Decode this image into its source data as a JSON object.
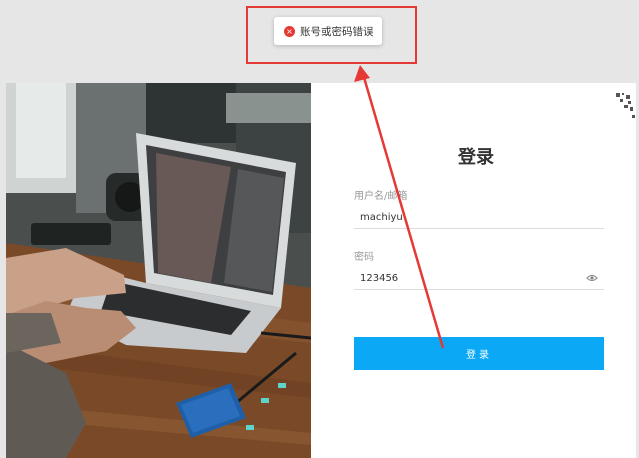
{
  "toast": {
    "icon": "×",
    "message": "账号或密码错误"
  },
  "login": {
    "title": "登录",
    "username_label": "用户名/邮箱",
    "username_value": "machiyu",
    "password_label": "密码",
    "password_value": "123456",
    "button_label": "登录"
  },
  "icons": {
    "toast": "error-circle-icon",
    "eye": "eye-icon",
    "corner": "qr-code-icon"
  },
  "colors": {
    "accent": "#0aa8f5",
    "error": "#e53935",
    "annotation": "#e53935"
  }
}
